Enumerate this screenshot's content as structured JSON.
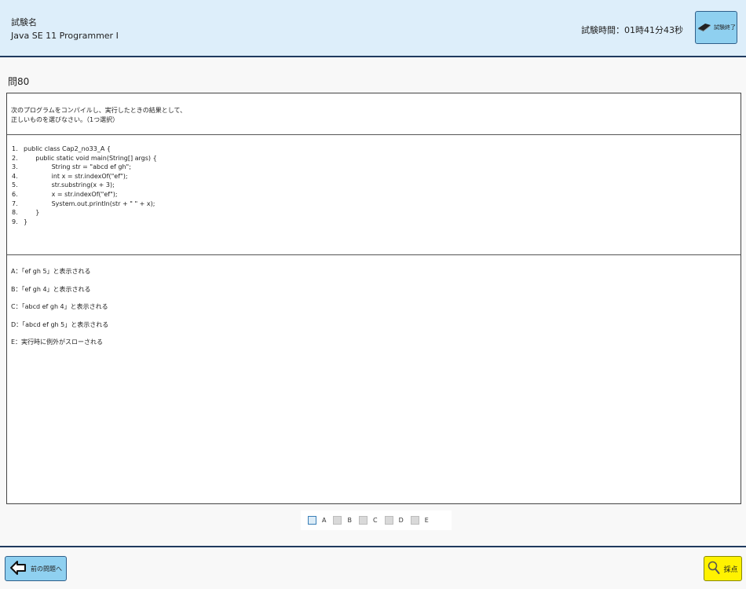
{
  "header": {
    "exam_label": "試験名",
    "exam_name": "Java SE 11 Programmer Ⅰ",
    "timer": "試験時間：01時41分43秒",
    "end_label": "試験終了"
  },
  "question": {
    "number": "問80",
    "text_lines": [
      "次のプログラムをコンパイルし、実行したときの結果として、",
      "正しいものを選びなさい。（1つ選択）"
    ],
    "code": [
      {
        "n": "1.",
        "c": "public class Cap2_no33_A {"
      },
      {
        "n": "2.",
        "c": "      public static void main(String[] args) {"
      },
      {
        "n": "3.",
        "c": "              String str = \"abcd ef gh\";"
      },
      {
        "n": "4.",
        "c": "              int x = str.indexOf(\"ef\");"
      },
      {
        "n": "5.",
        "c": "              str.substring(x + 3);"
      },
      {
        "n": "6.",
        "c": "              x = str.indexOf(\"ef\");"
      },
      {
        "n": "7.",
        "c": "              System.out.println(str + \" \" + x);"
      },
      {
        "n": "8.",
        "c": "      }"
      },
      {
        "n": "9.",
        "c": "}"
      }
    ],
    "options": [
      "A：「ef gh 5」と表示される",
      "B：「ef gh 4」と表示される",
      "C：「abcd ef gh 4」と表示される",
      "D：「abcd ef gh 5」と表示される",
      "E：実行時に例外がスローされる"
    ]
  },
  "answers": [
    "A",
    "B",
    "C",
    "D",
    "E"
  ],
  "footer": {
    "prev_label": "前の問題へ",
    "score_label": "採点"
  },
  "colors": {
    "header_bg": "#ddeefa",
    "button_blue": "#8fd0f0",
    "button_yellow": "#fff200",
    "divider": "#1f3a5f"
  },
  "icons": {
    "end": "book-icon",
    "prev": "arrow-left-icon",
    "score": "magnifier-icon"
  }
}
